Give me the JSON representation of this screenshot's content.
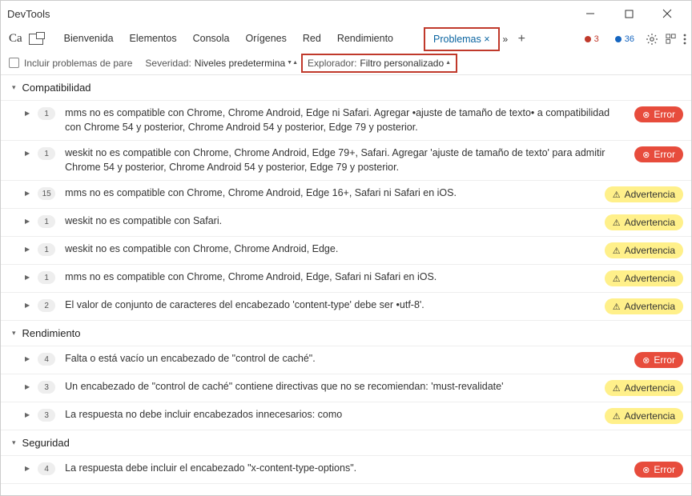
{
  "window": {
    "title": "DevTools"
  },
  "tabs": {
    "ca_label": "Ca",
    "items": [
      "Bienvenida",
      "Elementos",
      "Consola",
      "Orígenes",
      "Red",
      "Rendimiento"
    ],
    "active": "Problemas ×"
  },
  "counters": {
    "errors": "3",
    "info": "36"
  },
  "filters": {
    "include_label": "Incluir problemas de pare",
    "severity_label": "Severidad:",
    "severity_value": "Niveles predetermina",
    "browser_label": "Explorador:",
    "browser_value": "Filtro personalizado"
  },
  "sections": [
    {
      "name": "Compatibilidad",
      "items": [
        {
          "count": "1",
          "text": "mms no es compatible con Chrome, Chrome Android, Edge ni Safari. Agregar •ajuste de tamaño de texto• a compatibilidad con Chrome 54 y posterior, Chrome Android 54 y posterior, Edge 79 y posterior.",
          "status": "error",
          "status_label": "Error"
        },
        {
          "count": "1",
          "text": "weskit no es compatible con Chrome, Chrome Android, Edge 79+, Safari. Agregar 'ajuste de tamaño de texto' para admitir Chrome 54 y posterior, Chrome Android 54 y posterior, Edge 79 y posterior.",
          "status": "error",
          "status_label": "Error"
        },
        {
          "count": "15",
          "text": "mms no es compatible con Chrome, Chrome Android, Edge 16+, Safari ni Safari en iOS.",
          "status": "warning",
          "status_label": "Advertencia"
        },
        {
          "count": "1",
          "text": "weskit no es compatible con Safari.",
          "status": "warning",
          "status_label": "Advertencia"
        },
        {
          "count": "1",
          "text": "weskit no es compatible con Chrome, Chrome Android, Edge.",
          "status": "warning",
          "status_label": "Advertencia"
        },
        {
          "count": "1",
          "text": "mms no es compatible con Chrome, Chrome Android, Edge, Safari ni Safari en iOS.",
          "status": "warning",
          "status_label": "Advertencia"
        },
        {
          "count": "2",
          "text": "El valor de conjunto de caracteres del encabezado 'content-type' debe ser •utf-8'.",
          "status": "warning",
          "status_label": "Advertencia"
        }
      ]
    },
    {
      "name": "Rendimiento",
      "items": [
        {
          "count": "4",
          "text": "Falta o está vacío un encabezado de \"control de caché\".",
          "status": "error",
          "status_label": "Error"
        },
        {
          "count": "3",
          "text": "Un encabezado de \"control de caché\" contiene directivas que no se recomiendan: 'must-revalidate'",
          "status": "warning",
          "status_label": "Advertencia"
        },
        {
          "count": "3",
          "text": "La respuesta no debe incluir encabezados innecesarios: como",
          "status": "warning",
          "status_label": "Advertencia"
        }
      ]
    },
    {
      "name": "Seguridad",
      "items": [
        {
          "count": "4",
          "text": "La respuesta debe incluir el encabezado \"x-content-type-options\".",
          "status": "error",
          "status_label": "Error"
        }
      ]
    }
  ],
  "badge_icons": {
    "error": "⊗",
    "warning": "⚠"
  }
}
